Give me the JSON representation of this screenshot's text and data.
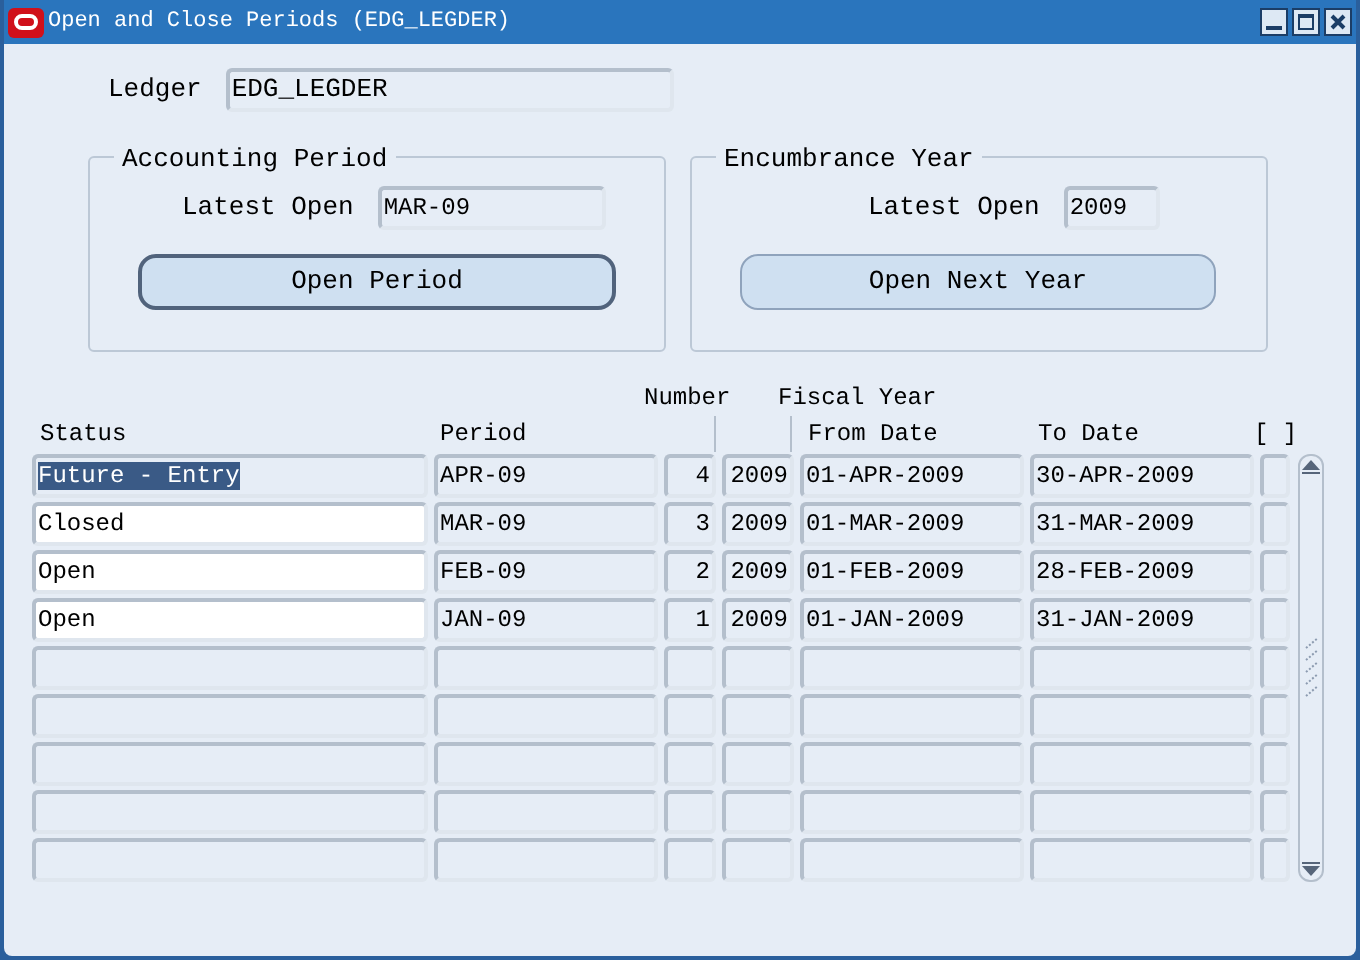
{
  "window": {
    "title": "Open and Close Periods (EDG_LEGDER)"
  },
  "ledger": {
    "label": "Ledger",
    "value": "EDG_LEGDER"
  },
  "accounting_period": {
    "title": "Accounting Period",
    "latest_open_label": "Latest Open",
    "latest_open": "MAR-09",
    "button": "Open Period",
    "button_focused": true
  },
  "encumbrance_year": {
    "title": "Encumbrance Year",
    "latest_open_label": "Latest Open",
    "latest_open": "2009",
    "button": "Open Next Year",
    "button_focused": false
  },
  "table": {
    "group_headers": [
      "Number",
      "Fiscal Year"
    ],
    "columns": [
      "Status",
      "Period",
      "From Date",
      "To Date",
      "[ ]"
    ],
    "rows": [
      {
        "status": "Future - Entry",
        "period": "APR-09",
        "number": "4",
        "fiscal_year": "2009",
        "from_date": "01-APR-2009",
        "to_date": "30-APR-2009",
        "selected": true,
        "editable": false
      },
      {
        "status": "Closed",
        "period": "MAR-09",
        "number": "3",
        "fiscal_year": "2009",
        "from_date": "01-MAR-2009",
        "to_date": "31-MAR-2009",
        "selected": false,
        "editable": true
      },
      {
        "status": "Open",
        "period": "FEB-09",
        "number": "2",
        "fiscal_year": "2009",
        "from_date": "01-FEB-2009",
        "to_date": "28-FEB-2009",
        "selected": false,
        "editable": true
      },
      {
        "status": "Open",
        "period": "JAN-09",
        "number": "1",
        "fiscal_year": "2009",
        "from_date": "01-JAN-2009",
        "to_date": "31-JAN-2009",
        "selected": false,
        "editable": true
      }
    ]
  }
}
